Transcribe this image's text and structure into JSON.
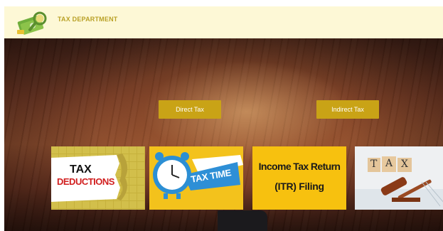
{
  "header": {
    "brand": "TAX DEPARTMENT",
    "logo_icon": "money-magnifier-icon"
  },
  "buttons": {
    "direct": "Direct Tax",
    "indirect": "Indirect Tax"
  },
  "cards": [
    {
      "line1": "TAX",
      "line2": "DEDUCTIONS"
    },
    {
      "text": "TAX TIME"
    },
    {
      "line1": "Income Tax Return",
      "line2": "(ITR) Filing"
    },
    {
      "letters": [
        "T",
        "A",
        "X"
      ]
    }
  ],
  "colors": {
    "header_bg": "#fdf8d6",
    "brand_text": "#b9a126",
    "button_bg": "#c9a316"
  }
}
